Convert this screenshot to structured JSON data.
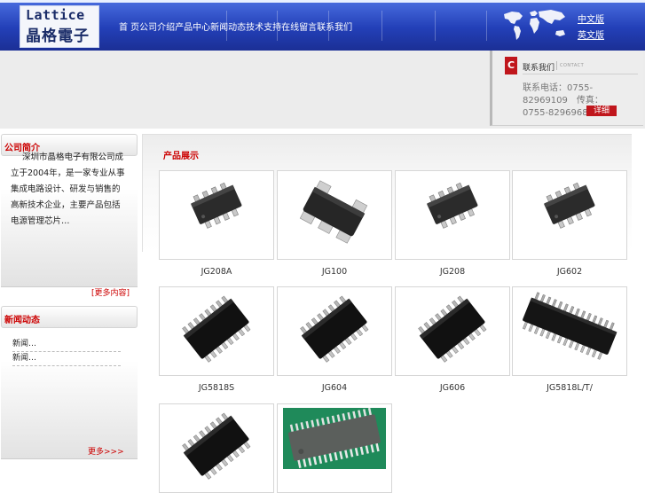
{
  "header": {
    "logo_en": "Lattice",
    "logo_cn": "晶格電子",
    "nav_text": "首 页公司介绍产品中心新闻动态技术支持在线留言联系我们",
    "links": [
      "中文版",
      "英文版"
    ]
  },
  "contact": {
    "icon_letter": "C",
    "title": "联系我们",
    "subtitle": "CONTACT",
    "phone_text": "联系电话：0755-82969109　传真：0755-82969681",
    "more_label": "详细"
  },
  "about": {
    "heading": "公司简介",
    "text": "深圳市晶格电子有限公司成立于2004年，是一家专业从事集成电路设计、研发与销售的高新技术企业，主要产品包括电源管理芯片…",
    "more_label": "[更多内容]"
  },
  "news": {
    "heading": "新闻动态",
    "items": [
      "新闻…",
      "新闻…"
    ],
    "more_label": "更多>>>"
  },
  "products": {
    "heading": "产品展示",
    "items": [
      {
        "name": "JG208A",
        "image": "so8-chip"
      },
      {
        "name": "JG100",
        "image": "sot23-chip"
      },
      {
        "name": "JG208",
        "image": "so8-chip"
      },
      {
        "name": "JG602",
        "image": "so8-chip"
      },
      {
        "name": "JG5818S",
        "image": "so16-chip"
      },
      {
        "name": "JG604",
        "image": "so16-chip"
      },
      {
        "name": "JG606",
        "image": "so16-chip"
      },
      {
        "name": "JG5818L/T/",
        "image": "tssop-chip"
      },
      {
        "name": "",
        "image": "so16-chip"
      },
      {
        "name": "",
        "image": "ssop-photo"
      }
    ]
  },
  "colors": {
    "header_blue": "#2340b8",
    "accent_red": "#cc0000"
  }
}
